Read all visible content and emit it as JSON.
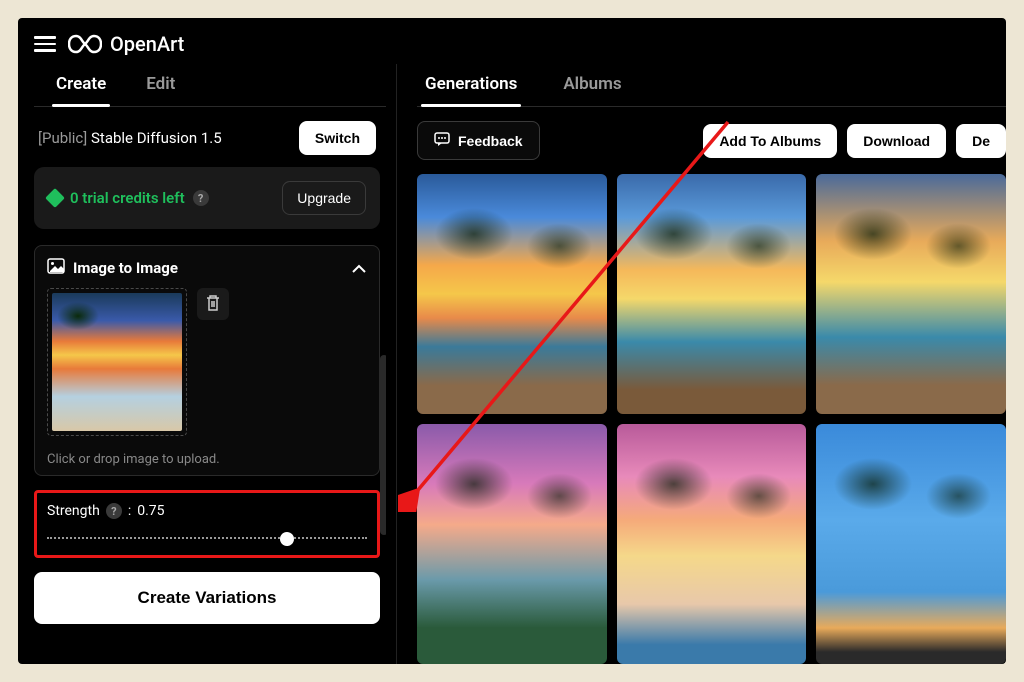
{
  "header": {
    "brand": "OpenArt"
  },
  "sidebar": {
    "tabs": [
      "Create",
      "Edit"
    ],
    "activeTab": 0,
    "model": {
      "prefix": "[Public]",
      "name": "Stable Diffusion 1.5",
      "switchLabel": "Switch"
    },
    "credits": {
      "text": "0 trial credits left",
      "upgradeLabel": "Upgrade"
    },
    "panel": {
      "title": "Image to Image",
      "hint": "Click or drop image to upload."
    },
    "strength": {
      "label": "Strength",
      "value": "0.75",
      "percent": 75
    },
    "createButton": "Create Variations"
  },
  "main": {
    "tabs": [
      "Generations",
      "Albums"
    ],
    "activeTab": 0,
    "feedbackLabel": "Feedback",
    "actions": {
      "addToAlbums": "Add To Albums",
      "download": "Download",
      "delete": "De"
    }
  }
}
